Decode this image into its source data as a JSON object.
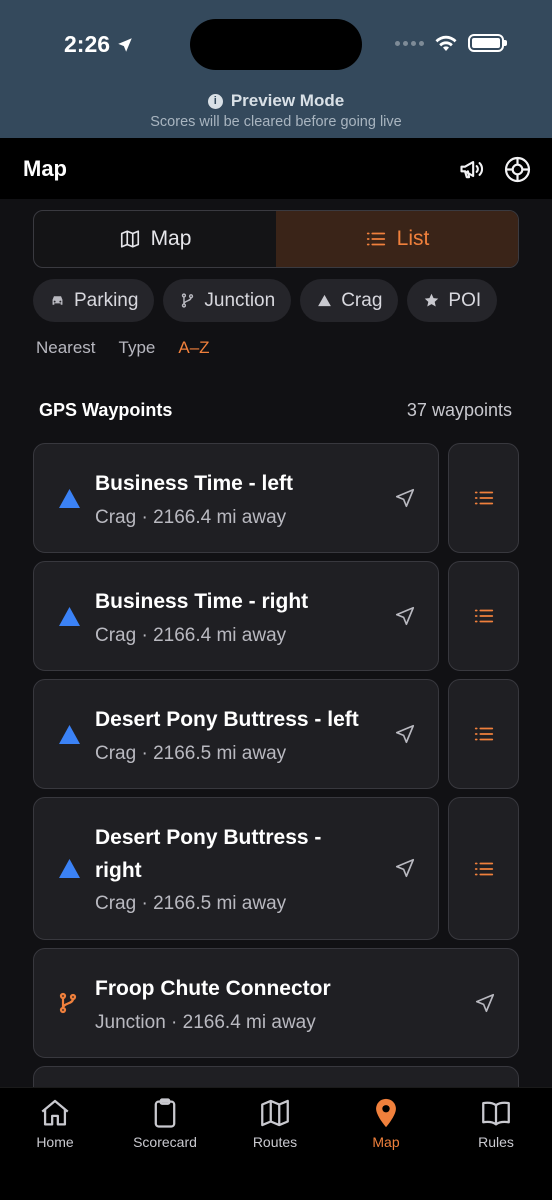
{
  "status": {
    "time": "2:26"
  },
  "preview": {
    "title": "Preview Mode",
    "subtitle": "Scores will be cleared before going live"
  },
  "header": {
    "title": "Map"
  },
  "segmented": {
    "map_label": "Map",
    "list_label": "List"
  },
  "filters": {
    "parking": "Parking",
    "junction": "Junction",
    "crag": "Crag",
    "poi": "POI"
  },
  "sort": {
    "nearest": "Nearest",
    "type": "Type",
    "az": "A–Z"
  },
  "section": {
    "title": "GPS Waypoints",
    "count": "37 waypoints"
  },
  "waypoints": [
    {
      "name": "Business Time - left",
      "meta": "Crag · 2166.4 mi away"
    },
    {
      "name": "Business Time - right",
      "meta": "Crag · 2166.4 mi away"
    },
    {
      "name": "Desert Pony Buttress - left",
      "meta": "Crag · 2166.5 mi away"
    },
    {
      "name_line1": "Desert Pony Buttress -",
      "name_line2": "right",
      "meta": "Crag · 2166.5 mi away"
    },
    {
      "name": "Froop Chute Connector",
      "meta": "Junction · 2166.4 mi away"
    }
  ],
  "tabs": {
    "home": "Home",
    "scorecard": "Scorecard",
    "routes": "Routes",
    "map": "Map",
    "rules": "Rules"
  },
  "colors": {
    "accent": "#f0803c",
    "crag_blue": "#3b82f6",
    "banner": "#34495c"
  }
}
